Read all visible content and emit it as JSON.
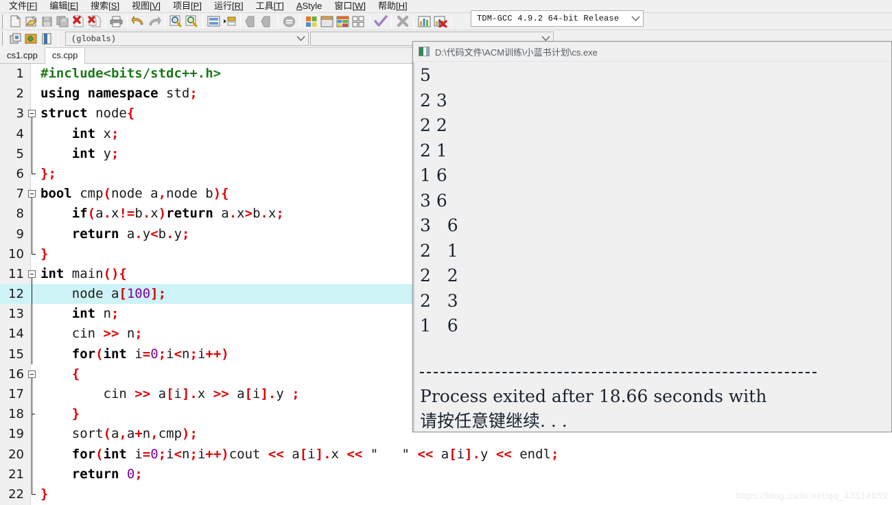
{
  "menu": {
    "items": [
      {
        "label": "文件",
        "accel": "F"
      },
      {
        "label": "编辑",
        "accel": "E"
      },
      {
        "label": "搜索",
        "accel": "S"
      },
      {
        "label": "视图",
        "accel": "V"
      },
      {
        "label": "项目",
        "accel": "P"
      },
      {
        "label": "运行",
        "accel": "R"
      },
      {
        "label": "工具",
        "accel": "T"
      },
      {
        "label": "AStyle",
        "accel": ""
      },
      {
        "label": "窗口",
        "accel": "W"
      },
      {
        "label": "帮助",
        "accel": "H"
      }
    ]
  },
  "toolbar": {
    "buttons": [
      "new-file-icon",
      "open-file-icon",
      "save-file-icon",
      "save-all-icon",
      "close-file-icon",
      "close-all-icon",
      "print-icon",
      "undo-icon",
      "redo-icon",
      "find-icon",
      "replace-icon",
      "goto-line-icon",
      "indent-icon",
      "back-icon",
      "forward-icon",
      "toggle-bookmark-icon",
      "compile-icon",
      "run-icon",
      "compile-and-run-icon",
      "rebuild-all-icon",
      "syntax-check-icon",
      "stop-execution-icon",
      "profile-icon",
      "delete-profile-icon"
    ],
    "compiler_set": "TDM-GCC 4.9.2 64-bit Release",
    "scope_selector": "(globals)",
    "secondary_selector": "",
    "row2_buttons": [
      "project-manager-icon",
      "add-to-project-icon",
      "class-browser-icon"
    ]
  },
  "tabs": [
    {
      "label": "cs1.cpp",
      "active": false
    },
    {
      "label": "cs.cpp",
      "active": true
    }
  ],
  "editor": {
    "highlighted_line": 12,
    "lines": [
      {
        "n": 1,
        "fold": "none",
        "tokens": [
          {
            "t": "#include<bits/stdc++.h>",
            "c": "pp"
          }
        ]
      },
      {
        "n": 2,
        "fold": "none",
        "tokens": [
          {
            "t": "using namespace",
            "c": "kw"
          },
          {
            "t": " std",
            "c": "id"
          },
          {
            "t": ";",
            "c": "pun"
          }
        ]
      },
      {
        "n": 3,
        "fold": "open",
        "tokens": [
          {
            "t": "struct",
            "c": "kw"
          },
          {
            "t": " node",
            "c": "id"
          },
          {
            "t": "{",
            "c": "pun"
          }
        ]
      },
      {
        "n": 4,
        "fold": "bar",
        "tokens": [
          {
            "t": "    ",
            "c": "id"
          },
          {
            "t": "int",
            "c": "kw"
          },
          {
            "t": " x",
            "c": "id"
          },
          {
            "t": ";",
            "c": "pun"
          }
        ]
      },
      {
        "n": 5,
        "fold": "bar",
        "tokens": [
          {
            "t": "    ",
            "c": "id"
          },
          {
            "t": "int",
            "c": "kw"
          },
          {
            "t": " y",
            "c": "id"
          },
          {
            "t": ";",
            "c": "pun"
          }
        ]
      },
      {
        "n": 6,
        "fold": "end",
        "tokens": [
          {
            "t": "};",
            "c": "pun"
          }
        ]
      },
      {
        "n": 7,
        "fold": "open",
        "tokens": [
          {
            "t": "bool",
            "c": "kw"
          },
          {
            "t": " cmp",
            "c": "id"
          },
          {
            "t": "(",
            "c": "pun"
          },
          {
            "t": "node a",
            "c": "id"
          },
          {
            "t": ",",
            "c": "pun"
          },
          {
            "t": "node b",
            "c": "id"
          },
          {
            "t": "){",
            "c": "pun"
          }
        ]
      },
      {
        "n": 8,
        "fold": "bar",
        "tokens": [
          {
            "t": "    ",
            "c": "id"
          },
          {
            "t": "if",
            "c": "kw"
          },
          {
            "t": "(",
            "c": "pun"
          },
          {
            "t": "a",
            "c": "id"
          },
          {
            "t": ".",
            "c": "pun"
          },
          {
            "t": "x",
            "c": "id"
          },
          {
            "t": "!=",
            "c": "pun"
          },
          {
            "t": "b",
            "c": "id"
          },
          {
            "t": ".",
            "c": "pun"
          },
          {
            "t": "x",
            "c": "id"
          },
          {
            "t": ")",
            "c": "pun"
          },
          {
            "t": "return",
            "c": "kw"
          },
          {
            "t": " a",
            "c": "id"
          },
          {
            "t": ".",
            "c": "pun"
          },
          {
            "t": "x",
            "c": "id"
          },
          {
            "t": ">",
            "c": "pun"
          },
          {
            "t": "b",
            "c": "id"
          },
          {
            "t": ".",
            "c": "pun"
          },
          {
            "t": "x",
            "c": "id"
          },
          {
            "t": ";",
            "c": "pun"
          }
        ]
      },
      {
        "n": 9,
        "fold": "bar",
        "tokens": [
          {
            "t": "    ",
            "c": "id"
          },
          {
            "t": "return",
            "c": "kw"
          },
          {
            "t": " a",
            "c": "id"
          },
          {
            "t": ".",
            "c": "pun"
          },
          {
            "t": "y",
            "c": "id"
          },
          {
            "t": "<",
            "c": "pun"
          },
          {
            "t": "b",
            "c": "id"
          },
          {
            "t": ".",
            "c": "pun"
          },
          {
            "t": "y",
            "c": "id"
          },
          {
            "t": ";",
            "c": "pun"
          }
        ]
      },
      {
        "n": 10,
        "fold": "end",
        "tokens": [
          {
            "t": "}",
            "c": "pun"
          }
        ]
      },
      {
        "n": 11,
        "fold": "open",
        "tokens": [
          {
            "t": "int",
            "c": "kw"
          },
          {
            "t": " main",
            "c": "id"
          },
          {
            "t": "(){",
            "c": "pun"
          }
        ]
      },
      {
        "n": 12,
        "fold": "bar",
        "tokens": [
          {
            "t": "    node a",
            "c": "id"
          },
          {
            "t": "[",
            "c": "pun"
          },
          {
            "t": "100",
            "c": "num"
          },
          {
            "t": "];",
            "c": "pun"
          }
        ]
      },
      {
        "n": 13,
        "fold": "bar",
        "tokens": [
          {
            "t": "    ",
            "c": "id"
          },
          {
            "t": "int",
            "c": "kw"
          },
          {
            "t": " n",
            "c": "id"
          },
          {
            "t": ";",
            "c": "pun"
          }
        ]
      },
      {
        "n": 14,
        "fold": "bar",
        "tokens": [
          {
            "t": "    cin ",
            "c": "id"
          },
          {
            "t": ">>",
            "c": "pun"
          },
          {
            "t": " n",
            "c": "id"
          },
          {
            "t": ";",
            "c": "pun"
          }
        ]
      },
      {
        "n": 15,
        "fold": "bar",
        "tokens": [
          {
            "t": "    ",
            "c": "id"
          },
          {
            "t": "for",
            "c": "kw"
          },
          {
            "t": "(",
            "c": "pun"
          },
          {
            "t": "int",
            "c": "kw"
          },
          {
            "t": " i",
            "c": "id"
          },
          {
            "t": "=",
            "c": "pun"
          },
          {
            "t": "0",
            "c": "num"
          },
          {
            "t": ";",
            "c": "pun"
          },
          {
            "t": "i",
            "c": "id"
          },
          {
            "t": "<",
            "c": "pun"
          },
          {
            "t": "n",
            "c": "id"
          },
          {
            "t": ";",
            "c": "pun"
          },
          {
            "t": "i",
            "c": "id"
          },
          {
            "t": "++)",
            "c": "pun"
          }
        ]
      },
      {
        "n": 16,
        "fold": "open2",
        "tokens": [
          {
            "t": "    ",
            "c": "id"
          },
          {
            "t": "{",
            "c": "pun"
          }
        ]
      },
      {
        "n": 17,
        "fold": "dot",
        "tokens": [
          {
            "t": "        cin ",
            "c": "id"
          },
          {
            "t": ">>",
            "c": "pun"
          },
          {
            "t": " a",
            "c": "id"
          },
          {
            "t": "[",
            "c": "pun"
          },
          {
            "t": "i",
            "c": "id"
          },
          {
            "t": "]",
            "c": "pun"
          },
          {
            "t": ".",
            "c": "pun"
          },
          {
            "t": "x ",
            "c": "id"
          },
          {
            "t": ">>",
            "c": "pun"
          },
          {
            "t": " a",
            "c": "id"
          },
          {
            "t": "[",
            "c": "pun"
          },
          {
            "t": "i",
            "c": "id"
          },
          {
            "t": "]",
            "c": "pun"
          },
          {
            "t": ".",
            "c": "pun"
          },
          {
            "t": "y ",
            "c": "id"
          },
          {
            "t": ";",
            "c": "pun"
          }
        ]
      },
      {
        "n": 18,
        "fold": "tick",
        "tokens": [
          {
            "t": "    ",
            "c": "id"
          },
          {
            "t": "}",
            "c": "pun"
          }
        ]
      },
      {
        "n": 19,
        "fold": "bar",
        "tokens": [
          {
            "t": "    sort",
            "c": "id"
          },
          {
            "t": "(",
            "c": "pun"
          },
          {
            "t": "a",
            "c": "id"
          },
          {
            "t": ",",
            "c": "pun"
          },
          {
            "t": "a",
            "c": "id"
          },
          {
            "t": "+",
            "c": "pun"
          },
          {
            "t": "n",
            "c": "id"
          },
          {
            "t": ",",
            "c": "pun"
          },
          {
            "t": "cmp",
            "c": "id"
          },
          {
            "t": ");",
            "c": "pun"
          }
        ]
      },
      {
        "n": 20,
        "fold": "bar",
        "tokens": [
          {
            "t": "    ",
            "c": "id"
          },
          {
            "t": "for",
            "c": "kw"
          },
          {
            "t": "(",
            "c": "pun"
          },
          {
            "t": "int",
            "c": "kw"
          },
          {
            "t": " i",
            "c": "id"
          },
          {
            "t": "=",
            "c": "pun"
          },
          {
            "t": "0",
            "c": "num"
          },
          {
            "t": ";",
            "c": "pun"
          },
          {
            "t": "i",
            "c": "id"
          },
          {
            "t": "<",
            "c": "pun"
          },
          {
            "t": "n",
            "c": "id"
          },
          {
            "t": ";",
            "c": "pun"
          },
          {
            "t": "i",
            "c": "id"
          },
          {
            "t": "++)",
            "c": "pun"
          },
          {
            "t": "cout ",
            "c": "id"
          },
          {
            "t": "<<",
            "c": "pun"
          },
          {
            "t": " a",
            "c": "id"
          },
          {
            "t": "[",
            "c": "pun"
          },
          {
            "t": "i",
            "c": "id"
          },
          {
            "t": "]",
            "c": "pun"
          },
          {
            "t": ".",
            "c": "pun"
          },
          {
            "t": "x ",
            "c": "id"
          },
          {
            "t": "<<",
            "c": "pun"
          },
          {
            "t": " ",
            "c": "id"
          },
          {
            "t": "\"   \"",
            "c": "str"
          },
          {
            "t": " ",
            "c": "id"
          },
          {
            "t": "<<",
            "c": "pun"
          },
          {
            "t": " a",
            "c": "id"
          },
          {
            "t": "[",
            "c": "pun"
          },
          {
            "t": "i",
            "c": "id"
          },
          {
            "t": "]",
            "c": "pun"
          },
          {
            "t": ".",
            "c": "pun"
          },
          {
            "t": "y ",
            "c": "id"
          },
          {
            "t": "<<",
            "c": "pun"
          },
          {
            "t": " endl",
            "c": "id"
          },
          {
            "t": ";",
            "c": "pun"
          }
        ]
      },
      {
        "n": 21,
        "fold": "bar",
        "tokens": [
          {
            "t": "    ",
            "c": "id"
          },
          {
            "t": "return",
            "c": "kw"
          },
          {
            "t": " ",
            "c": "id"
          },
          {
            "t": "0",
            "c": "num"
          },
          {
            "t": ";",
            "c": "pun"
          }
        ]
      },
      {
        "n": 22,
        "fold": "end",
        "tokens": [
          {
            "t": "}",
            "c": "pun"
          }
        ]
      }
    ]
  },
  "console": {
    "title": "D:\\代码文件\\ACM训练\\小蓝书计划\\cs.exe",
    "lines": [
      "5",
      "2 3",
      "2 2",
      "2 1",
      "1 6",
      "3 6",
      "3   6",
      "2   1",
      "2   2",
      "2   3",
      "1   6",
      "",
      "--------------------------------",
      "Process exited after 18.66 seconds with",
      "请按任意键继续. . ."
    ]
  },
  "watermark": "https://blog.csdn.net/qq_43514659"
}
